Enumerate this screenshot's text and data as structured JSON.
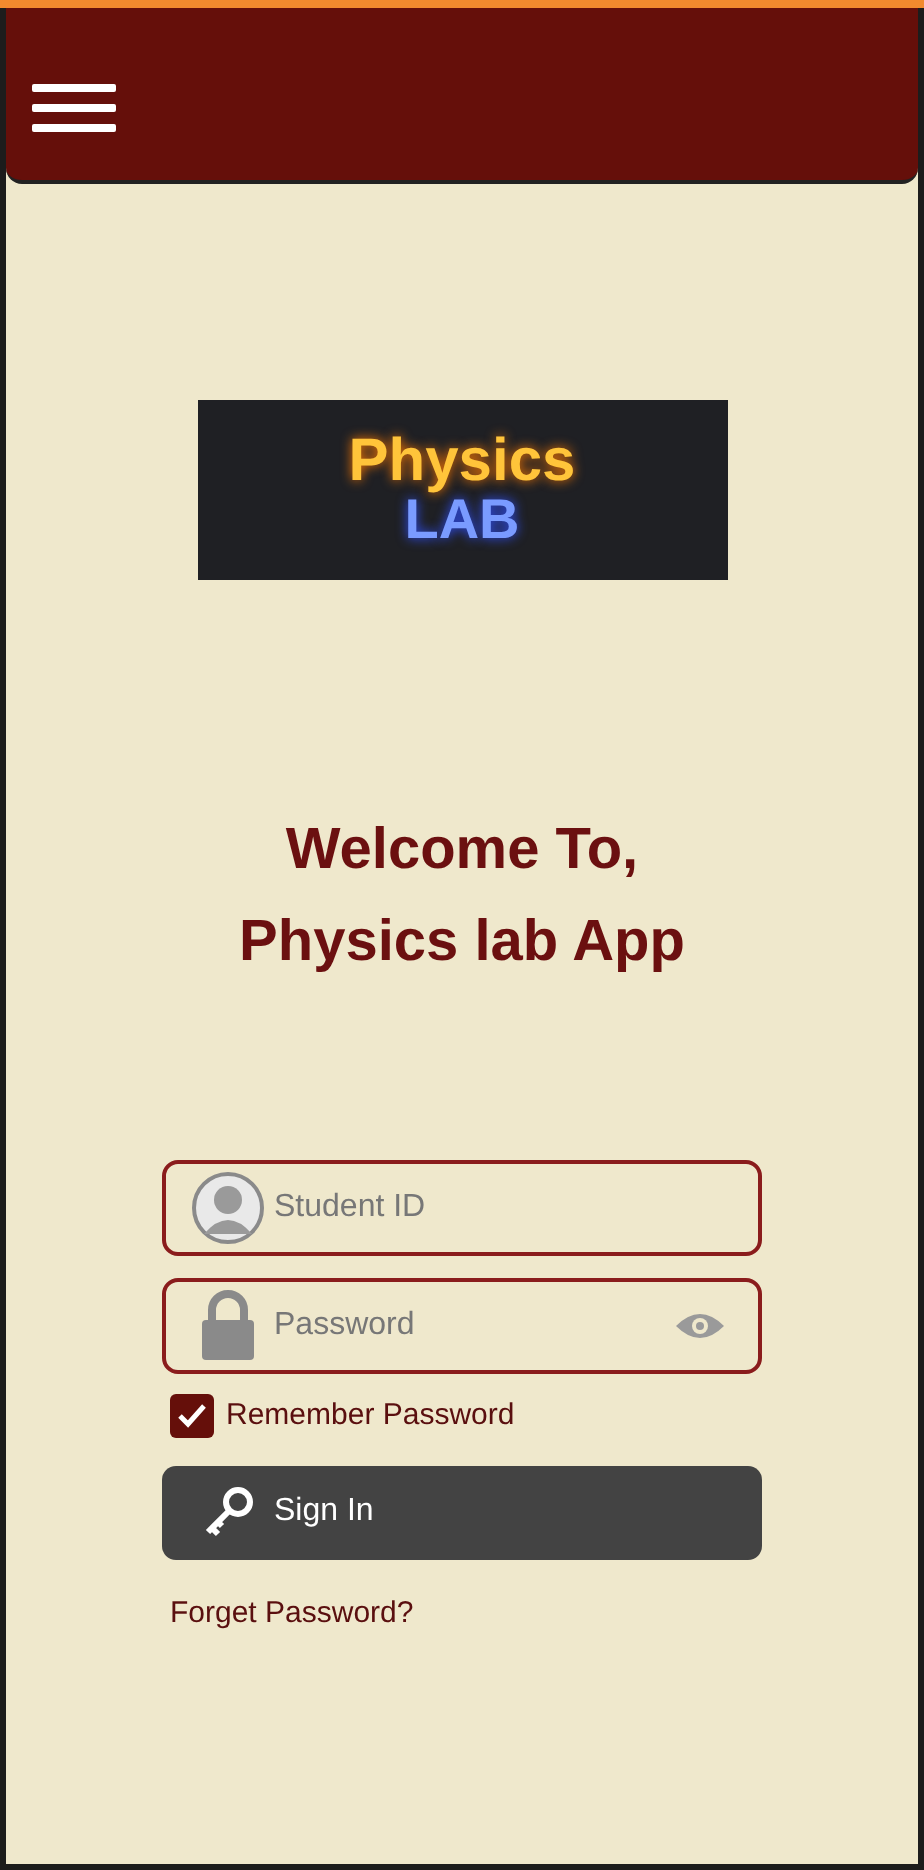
{
  "logo": {
    "line_1": "Physics",
    "line_2": "LAB"
  },
  "welcome": {
    "line_1": "Welcome To,",
    "line_2": "Physics lab App"
  },
  "student_id": {
    "placeholder": "Student ID"
  },
  "password": {
    "placeholder": "Password"
  },
  "remember": {
    "label": "Remember Password",
    "checked": true
  },
  "sign_in": {
    "label": "Sign In"
  },
  "forgot_link": "Forget Password?"
}
